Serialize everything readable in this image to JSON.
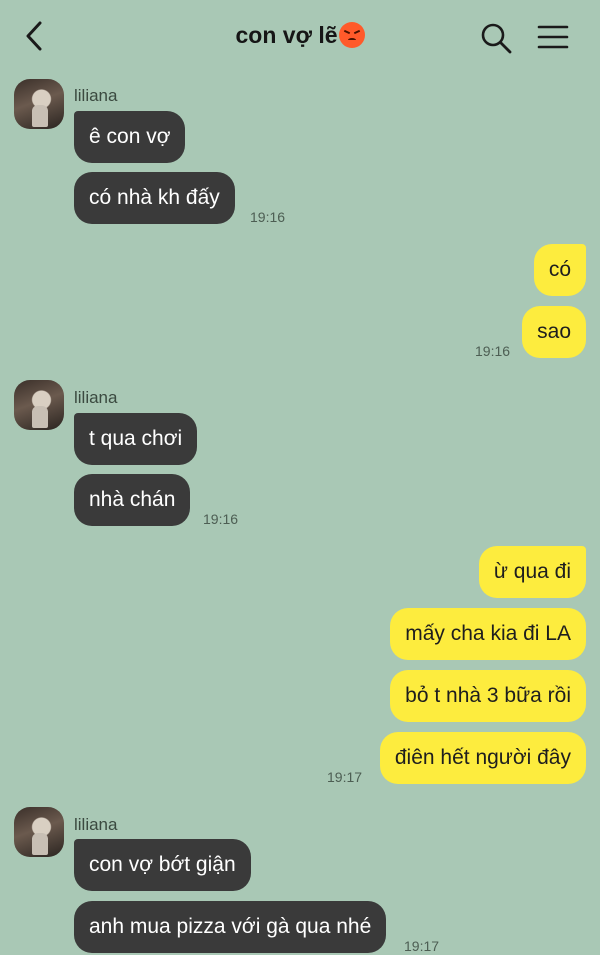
{
  "header": {
    "back_icon": "chevron-left-icon",
    "title": "con vợ lẽ",
    "title_emoji": "angry-face-emoji",
    "search_icon": "search-icon",
    "menu_icon": "hamburger-menu-icon"
  },
  "colors": {
    "background": "#a9c8b5",
    "incoming_bubble": "#3a3a3a",
    "outgoing_bubble": "#fdec3e"
  },
  "groups": [
    {
      "sender": "liliana",
      "messages": [
        "ê con vợ",
        "có nhà kh đấy"
      ],
      "time": "19:16"
    },
    {
      "sender": "",
      "messages": [
        "có",
        "sao"
      ],
      "time": "19:16"
    },
    {
      "sender": "liliana",
      "messages": [
        "t qua chơi",
        "nhà chán"
      ],
      "time": "19:16"
    },
    {
      "sender": "",
      "messages": [
        "ừ qua đi",
        "mấy cha kia đi LA",
        "bỏ t nhà 3 bữa rồi",
        "điên hết người đây"
      ],
      "time": "19:17"
    },
    {
      "sender": "liliana",
      "messages": [
        "con vợ bớt giận",
        "anh mua pizza với gà qua nhé"
      ],
      "time": "19:17"
    }
  ]
}
